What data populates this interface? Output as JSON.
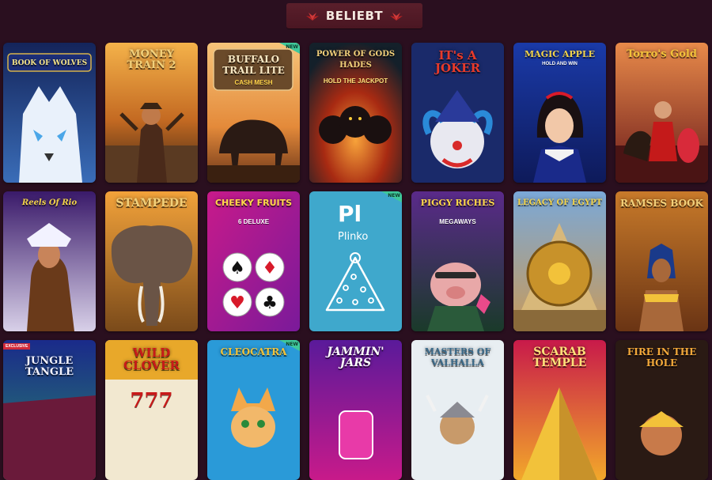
{
  "header": {
    "title": "BELIEBT"
  },
  "colors": {
    "page_bg": "#2a0f1f",
    "badge_bg": "#5a1f2b",
    "plinko_bg": "#3fa8cc",
    "new_badge": "#3fc89a"
  },
  "games": [
    {
      "title": "BOOK OF WOLVES",
      "theme": "wolf",
      "badge": ""
    },
    {
      "title": "MONEY TRAIN 2",
      "theme": "cowboy",
      "badge": ""
    },
    {
      "title": "BUFFALO TRAIL LITE",
      "subtitle": "CASH MESH",
      "theme": "buffalo",
      "badge": "NEW"
    },
    {
      "title": "POWER OF GODS HADES",
      "subtitle": "HOLD THE JACKPOT",
      "theme": "hades",
      "badge": ""
    },
    {
      "title": "IT's A JOKER",
      "theme": "joker",
      "badge": ""
    },
    {
      "title": "MAGIC APPLE",
      "subtitle": "HOLD AND WIN",
      "theme": "snow",
      "badge": ""
    },
    {
      "title": "Torro's Gold",
      "theme": "torro",
      "badge": ""
    },
    {
      "title": "Reels Of Rio",
      "theme": "rio",
      "badge": ""
    },
    {
      "title": "STAMPEDE",
      "theme": "elephant",
      "badge": ""
    },
    {
      "title": "CHEEKY FRUITS",
      "subtitle": "6 DELUXE",
      "theme": "cards",
      "badge": ""
    },
    {
      "code": "Pl",
      "title": "Plinko",
      "theme": "plinko",
      "badge": "NEW"
    },
    {
      "title": "PIGGY RICHES",
      "subtitle": "MEGAWAYS",
      "theme": "piggy",
      "badge": ""
    },
    {
      "title": "LEGACY OF EGYPT",
      "theme": "egypt",
      "badge": ""
    },
    {
      "title": "RAMSES BOOK",
      "theme": "ramses",
      "badge": ""
    },
    {
      "title": "JUNGLE TANGLE",
      "theme": "jungle",
      "badge": "EXCLUSIVE"
    },
    {
      "title": "WILD CLOVER",
      "subtitle": "777",
      "theme": "clover",
      "badge": ""
    },
    {
      "title": "CLEOCATRA",
      "theme": "cleo",
      "badge": "NEW"
    },
    {
      "title": "JAMMIN' JARS",
      "theme": "jars",
      "badge": ""
    },
    {
      "title": "MASTERS OF VALHALLA",
      "theme": "valhalla",
      "badge": ""
    },
    {
      "title": "SCARAB TEMPLE",
      "theme": "scarab",
      "badge": ""
    },
    {
      "title": "FIRE IN THE HOLE",
      "theme": "fire",
      "badge": ""
    }
  ]
}
